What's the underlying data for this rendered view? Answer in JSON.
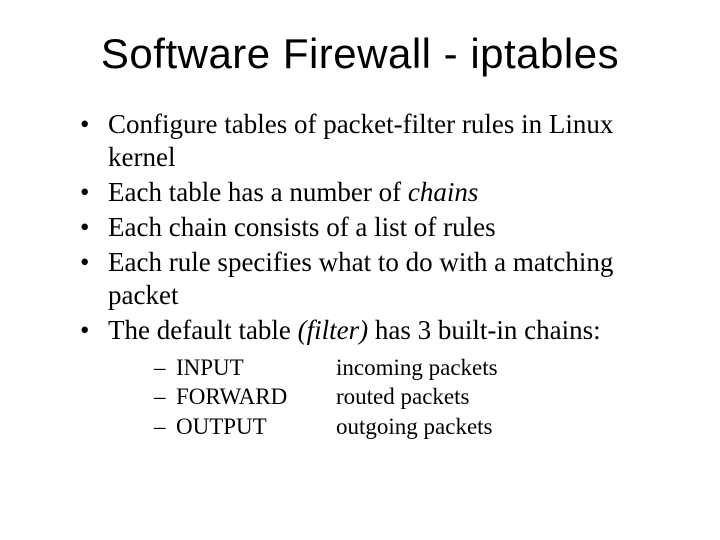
{
  "title": "Software Firewall - iptables",
  "bullets": [
    {
      "text": "Configure tables of packet-filter rules in Linux kernel"
    },
    {
      "text": "Each table has a number of ",
      "italic_suffix": "chains"
    },
    {
      "text": "Each chain consists of a list of rules"
    },
    {
      "text": "Each rule specifies what to do with a matching packet"
    },
    {
      "text": "The default table ",
      "italic_mid": "(filter)",
      "text_after": " has 3 built-in chains:"
    }
  ],
  "sub_items": [
    {
      "name": "INPUT",
      "desc": "incoming packets"
    },
    {
      "name": "FORWARD",
      "desc": "routed packets"
    },
    {
      "name": "OUTPUT",
      "desc": "outgoing packets"
    }
  ]
}
